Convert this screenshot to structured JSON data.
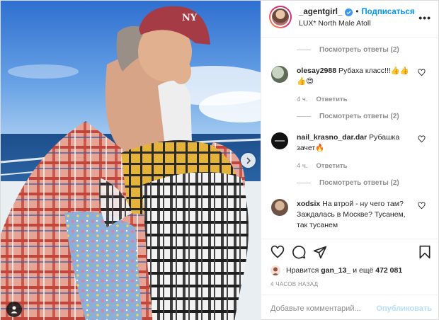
{
  "header": {
    "username": "_agentgirl_",
    "follow_label": "Подписаться",
    "dot": "•",
    "location": "LUX* North Male Atoll",
    "more_label": "•••"
  },
  "comments": [
    {
      "type": "replies",
      "label": "Посмотреть ответы (2)"
    },
    {
      "type": "comment",
      "user": "olesay2988",
      "text": "Рубаха класс!!!👍👍👍😍",
      "meta_time": "4 ч.",
      "reply_label": "Ответить"
    },
    {
      "type": "replies",
      "label": "Посмотреть ответы (2)"
    },
    {
      "type": "comment",
      "user": "nail_krasno_dar.dar",
      "text": "Рубашка зачет🔥",
      "meta_time": "4 ч.",
      "reply_label": "Ответить"
    },
    {
      "type": "replies",
      "label": "Посмотреть ответы (2)"
    },
    {
      "type": "comment",
      "user": "xodsix",
      "text": "На втрой - ну чего там? Заждалась в Москве? Тусанем, так тусанем"
    }
  ],
  "likes": {
    "prefix": "Нравится",
    "user": "gan_13_",
    "middle": "и ещё",
    "count": "472 081"
  },
  "time_ago": "4 ЧАСОВ НАЗАД",
  "add_comment": {
    "placeholder": "Добавьте комментарий...",
    "publish_label": "Опубликовать"
  },
  "colors": {
    "accent_blue": "#0095f6",
    "publish_disabled": "#b2dffc",
    "muted": "#8e8e8e",
    "text": "#262626"
  },
  "icons": [
    "verified-badge-icon",
    "more-options-icon",
    "heart-icon",
    "comment-icon",
    "share-icon",
    "save-bookmark-icon",
    "next-arrow-icon",
    "user-tag-icon"
  ]
}
